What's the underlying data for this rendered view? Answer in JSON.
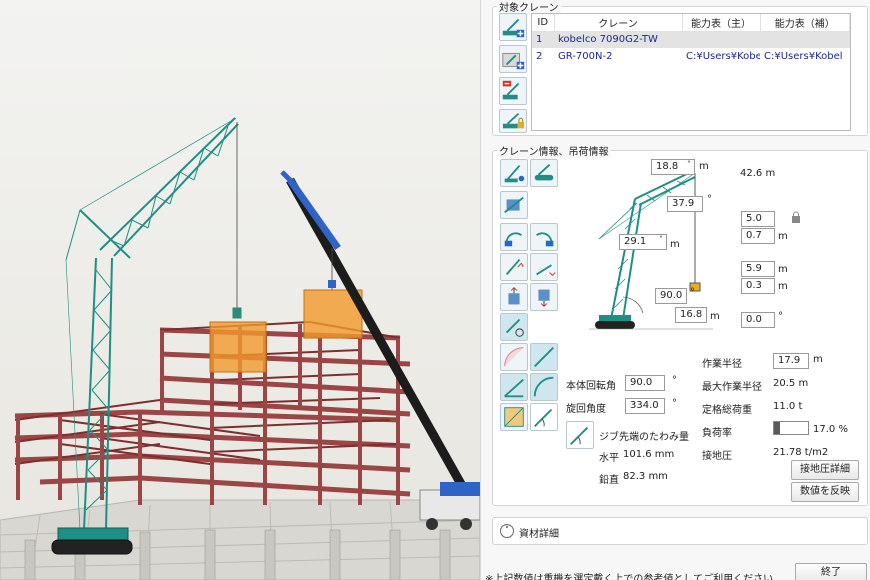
{
  "target_cranes": {
    "title": "対象クレーン",
    "columns": [
      "ID",
      "クレーン",
      "能力表（主）",
      "能力表（補）"
    ],
    "rows": [
      {
        "id": "1",
        "name": "kobelco 7090G2-TW",
        "main": "",
        "aux": "",
        "selected": true
      },
      {
        "id": "2",
        "name": "GR-700N-2",
        "main": "C:¥Users¥Kobel",
        "aux": "C:¥Users¥Kobel",
        "selected": false
      }
    ],
    "tools": [
      "add-crane-icon",
      "add-from-folder-icon",
      "delete-crane-icon",
      "lock-crane-icon"
    ]
  },
  "crane_info": {
    "title": "クレーン情報、吊荷情報",
    "diagram": {
      "boom_length": "18.8",
      "boom_angle": "37.9",
      "jib_length": "29.1",
      "main_angle": "90.0",
      "base_length": "16.8",
      "height": "42.6 m",
      "hook_a": "5.0",
      "hook_b": "0.7",
      "load_a": "5.9",
      "load_b": "0.3",
      "rotation_offset": "0.0",
      "unit_m": "m",
      "unit_deg": "°"
    },
    "body_rotation_label": "本体回転角",
    "body_rotation_value": "90.0",
    "swing_angle_label": "旋回角度",
    "swing_angle_value": "334.0",
    "deg_unit": "°",
    "jib_deflection_label": "ジブ先端のたわみ量",
    "horizontal_label": "水平",
    "horizontal_value": "101.6 mm",
    "vertical_label": "鉛直",
    "vertical_value": "82.3 mm",
    "working_radius_label": "作業半径",
    "working_radius_value": "17.9",
    "working_radius_unit": "m",
    "max_radius_label": "最大作業半径",
    "max_radius_value": "20.5 m",
    "rated_load_label": "定格総荷重",
    "rated_load_value": "11.0 t",
    "load_ratio_label": "負荷率",
    "load_ratio_value": "17.0 %",
    "load_ratio_fraction": 0.17,
    "ground_pressure_label": "接地圧",
    "ground_pressure_value": "21.78 t/m2",
    "ground_detail_button": "接地圧詳細",
    "reflect_button": "数値を反映"
  },
  "materials": {
    "label": "資材詳細"
  },
  "footer": {
    "note": "※上記数値は重機を選定戴く上での参考値としてご利用ください",
    "close_button": "終了"
  },
  "colors": {
    "crane_teal": "#1f8f85",
    "crane_blue": "#2f63c8",
    "steel_red": "#8c3a3a",
    "load_orange": "#f39a2c"
  }
}
